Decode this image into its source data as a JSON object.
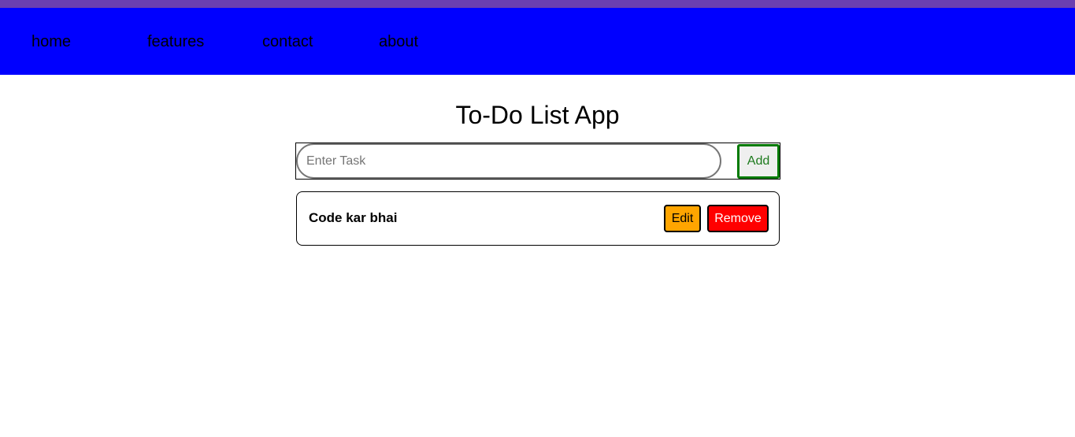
{
  "nav": {
    "links": [
      {
        "label": "home"
      },
      {
        "label": "features"
      },
      {
        "label": "contact"
      },
      {
        "label": "about"
      }
    ]
  },
  "app": {
    "title": "To-Do List App",
    "input": {
      "placeholder": "Enter Task",
      "value": ""
    },
    "add_label": "Add",
    "tasks": [
      {
        "text": "Code kar bhai",
        "edit_label": "Edit",
        "remove_label": "Remove"
      }
    ]
  },
  "colors": {
    "top_strip": "#6b3fb0",
    "navbar": "#0000ff",
    "add_border": "#007a00",
    "edit_bg": "#ffa500",
    "remove_bg": "#ff0000"
  }
}
